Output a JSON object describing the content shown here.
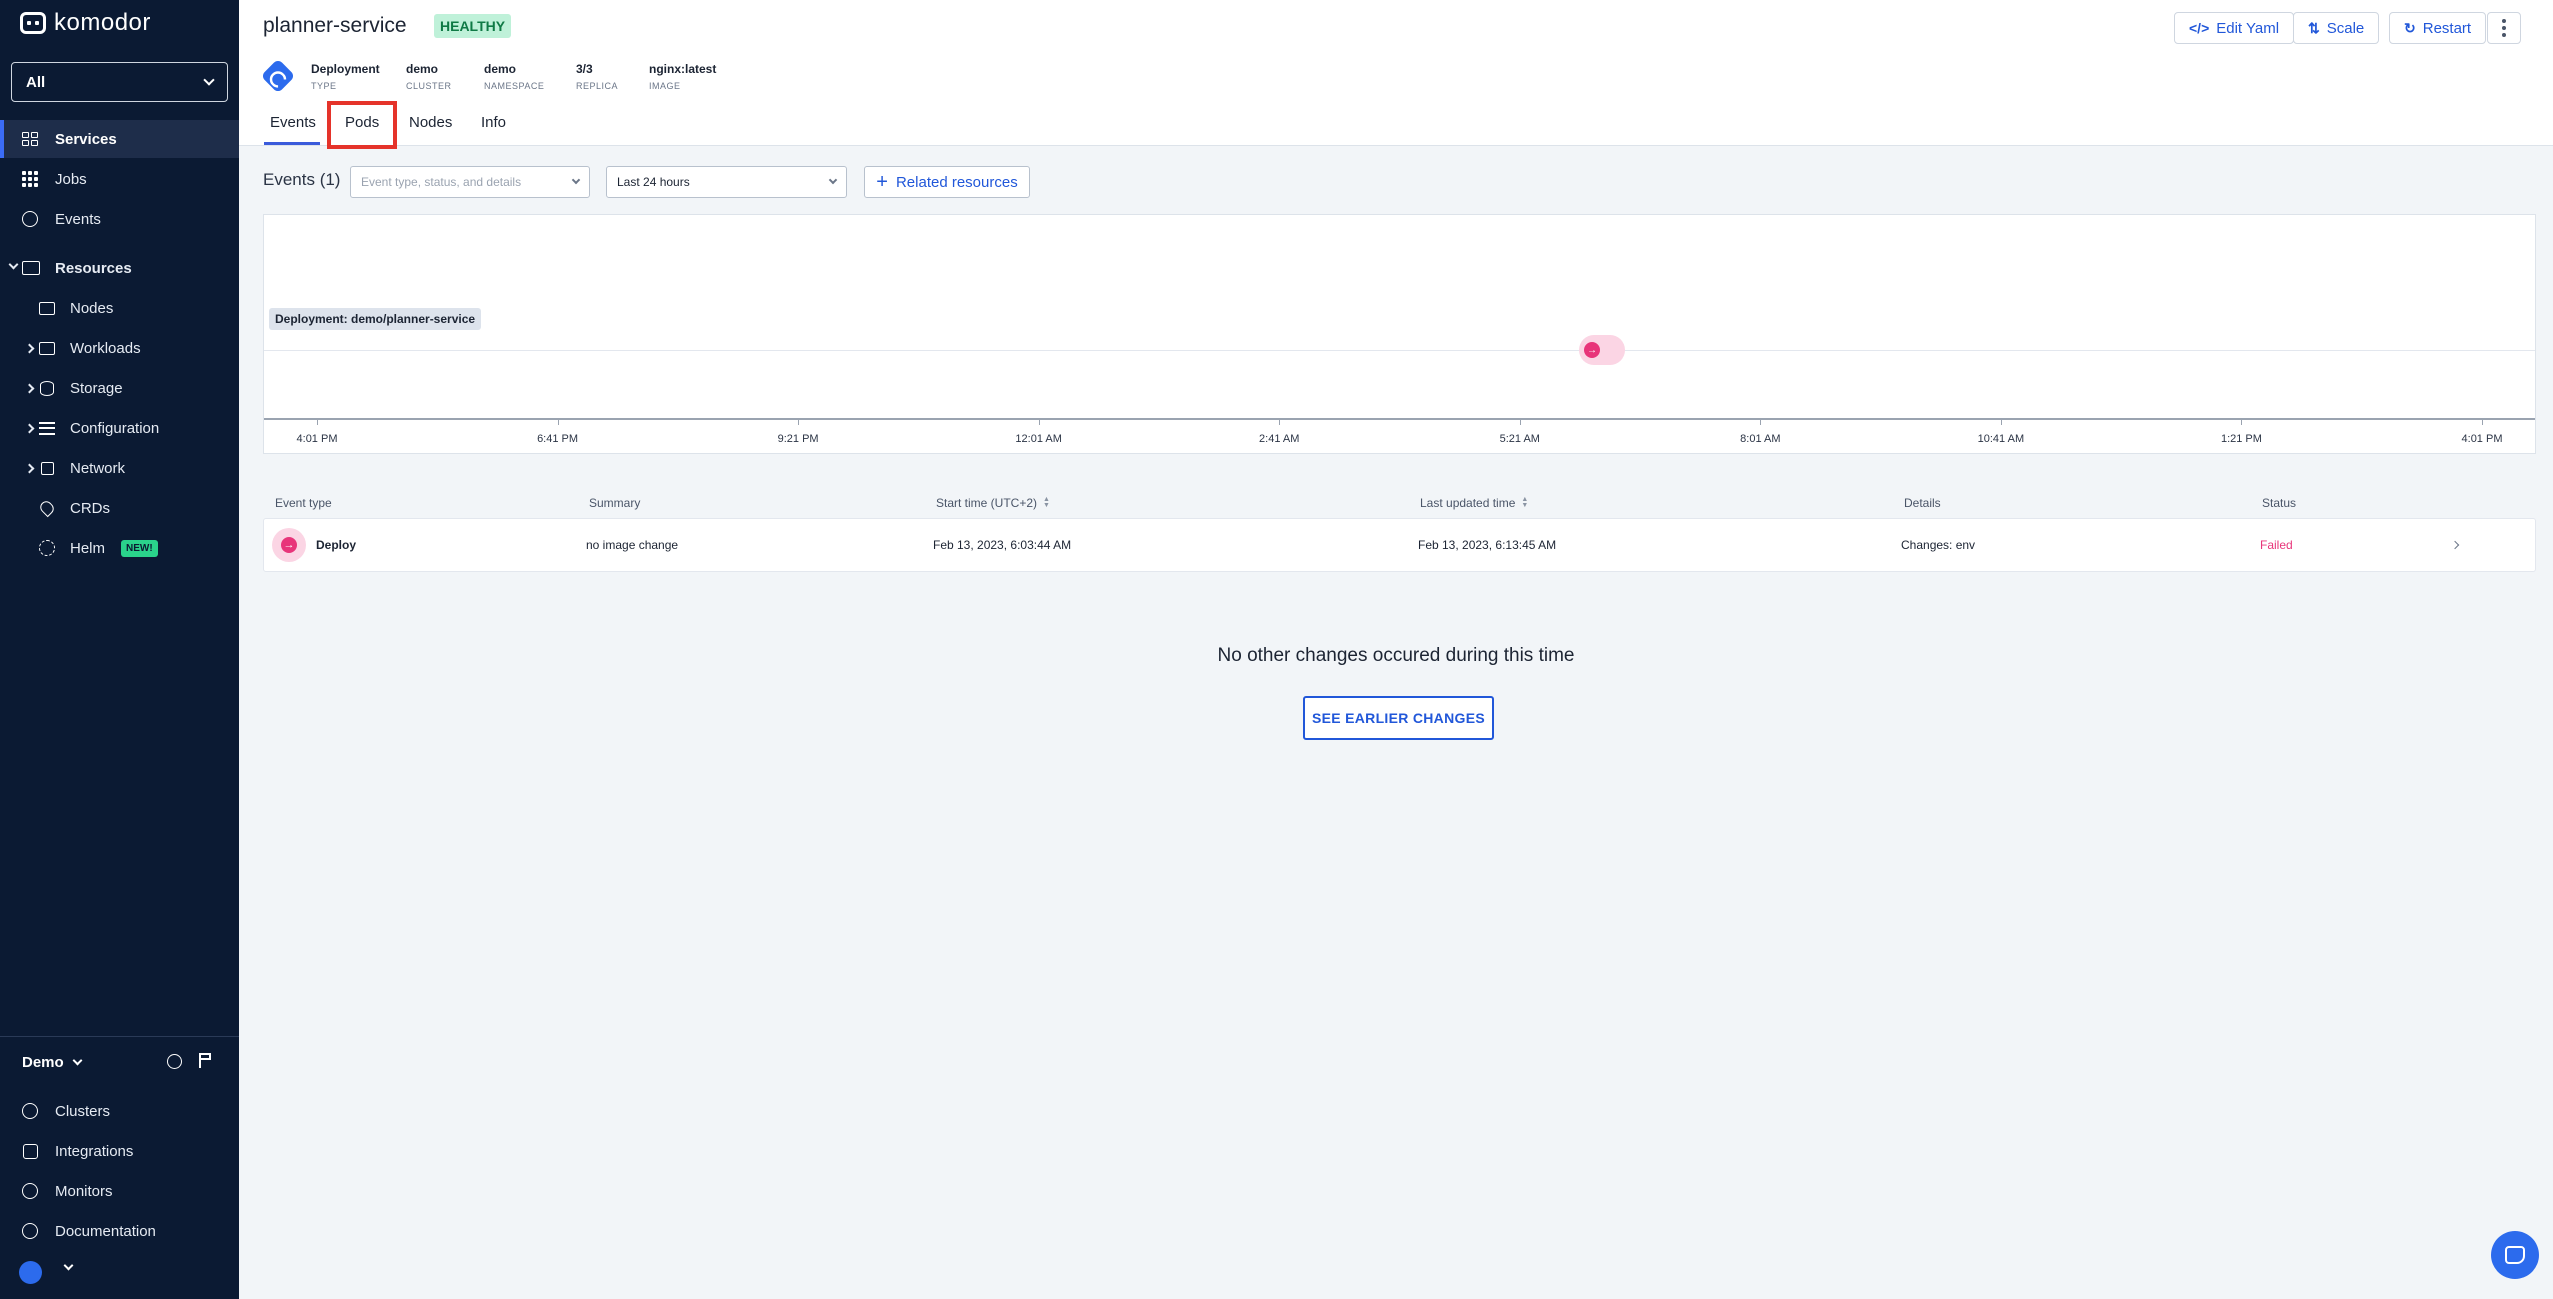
{
  "app": {
    "logo_text": "komodor"
  },
  "sidebar": {
    "workspace": "All",
    "nav": [
      {
        "label": "Services",
        "icon": "grid-icon"
      },
      {
        "label": "Jobs",
        "icon": "dots-icon"
      },
      {
        "label": "Events",
        "icon": "clock-icon"
      }
    ],
    "resources_label": "Resources",
    "resources": [
      {
        "label": "Nodes",
        "icon": "server-icon"
      },
      {
        "label": "Workloads",
        "icon": "workloads-icon"
      },
      {
        "label": "Storage",
        "icon": "database-icon"
      },
      {
        "label": "Configuration",
        "icon": "list-icon"
      },
      {
        "label": "Network",
        "icon": "network-icon"
      },
      {
        "label": "CRDs",
        "icon": "pin-icon"
      },
      {
        "label": "Helm",
        "icon": "helm-icon",
        "badge": "NEW!"
      }
    ],
    "account_name": "Demo",
    "footer": [
      {
        "label": "Clusters",
        "icon": "clusters-icon"
      },
      {
        "label": "Integrations",
        "icon": "puzzle-icon"
      },
      {
        "label": "Monitors",
        "icon": "monitor-icon"
      },
      {
        "label": "Documentation",
        "icon": "help-icon"
      }
    ]
  },
  "header": {
    "service_name": "planner-service",
    "health": "HEALTHY",
    "meta": [
      {
        "value": "Deployment",
        "key": "TYPE"
      },
      {
        "value": "demo",
        "key": "CLUSTER"
      },
      {
        "value": "demo",
        "key": "NAMESPACE"
      },
      {
        "value": "3/3",
        "key": "REPLICA"
      },
      {
        "value": "nginx:latest",
        "key": "IMAGE"
      }
    ],
    "tabs": [
      "Events",
      "Pods",
      "Nodes",
      "Info"
    ],
    "active_tab": "Events",
    "buttons": {
      "edit_yaml": "Edit Yaml",
      "scale": "Scale",
      "restart": "Restart"
    }
  },
  "filters": {
    "events_count": "Events (1)",
    "search_placeholder": "Event type, status, and details",
    "time_range": "Last 24 hours",
    "related_resources": "Related resources"
  },
  "chart_data": {
    "type": "scatter",
    "title": "",
    "row_label": "Deployment: demo/planner-service",
    "x_ticks": [
      "4:01 PM",
      "6:41 PM",
      "9:21 PM",
      "12:01 AM",
      "2:41 AM",
      "5:21 AM",
      "8:01 AM",
      "10:41 AM",
      "1:21 PM",
      "4:01 PM"
    ],
    "events": [
      {
        "type": "Deploy",
        "status": "Failed",
        "position_between_ticks": 5.3
      }
    ]
  },
  "table": {
    "columns": [
      "Event type",
      "Summary",
      "Start time (UTC+2)",
      "Last updated time",
      "Details",
      "Status"
    ],
    "rows": [
      {
        "event_type": "Deploy",
        "summary": "no image change",
        "start_time": "Feb 13, 2023, 6:03:44 AM",
        "last_updated": "Feb 13, 2023, 6:13:45 AM",
        "details": "Changes: env",
        "status": "Failed"
      }
    ]
  },
  "empty_state": {
    "message": "No other changes occured during this time",
    "button": "SEE EARLIER CHANGES"
  },
  "colors": {
    "sidebar_bg": "#0b1a33",
    "accent": "#2157d9",
    "failed": "#e8357a",
    "healthy_bg": "#bff1d9"
  }
}
